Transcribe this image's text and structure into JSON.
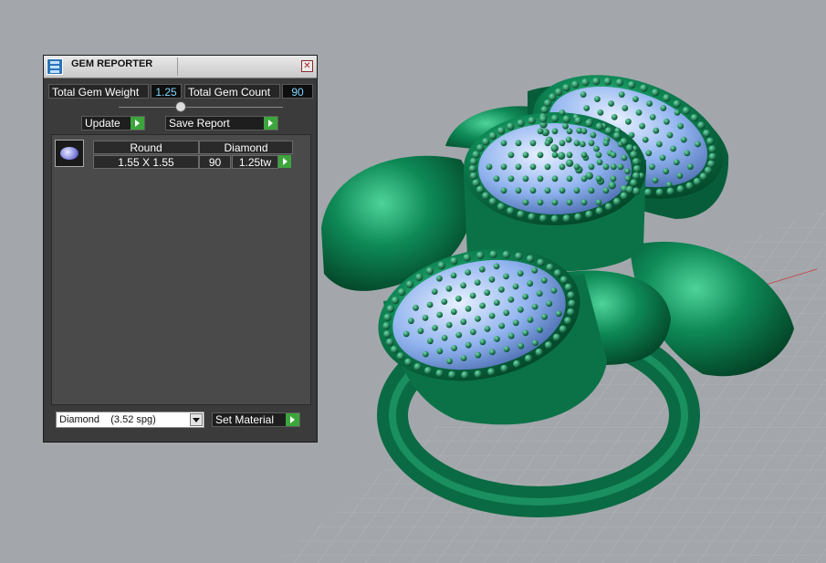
{
  "window": {
    "title": "GEM REPORTER",
    "close_glyph": "✕"
  },
  "summary": {
    "total_weight_label": "Total Gem Weight",
    "total_weight_value": "1.25",
    "total_count_label": "Total Gem Count",
    "total_count_value": "90"
  },
  "toolbar": {
    "update_label": "Update",
    "save_report_label": "Save Report"
  },
  "table": {
    "columns": [
      "Round",
      "Diamond"
    ],
    "rows": [
      {
        "size": "1.55 X 1.55",
        "count": "90",
        "weight": "1.25tw"
      }
    ]
  },
  "material": {
    "selected": "Diamond    (3.52 spg)",
    "set_label": "Set Material"
  },
  "colors": {
    "viewport_bg": "#a3a7ab",
    "ring_green": "#0f7a4f",
    "gem_blue": "#9fc0f5",
    "accent_arrow": "#3ca53c"
  }
}
